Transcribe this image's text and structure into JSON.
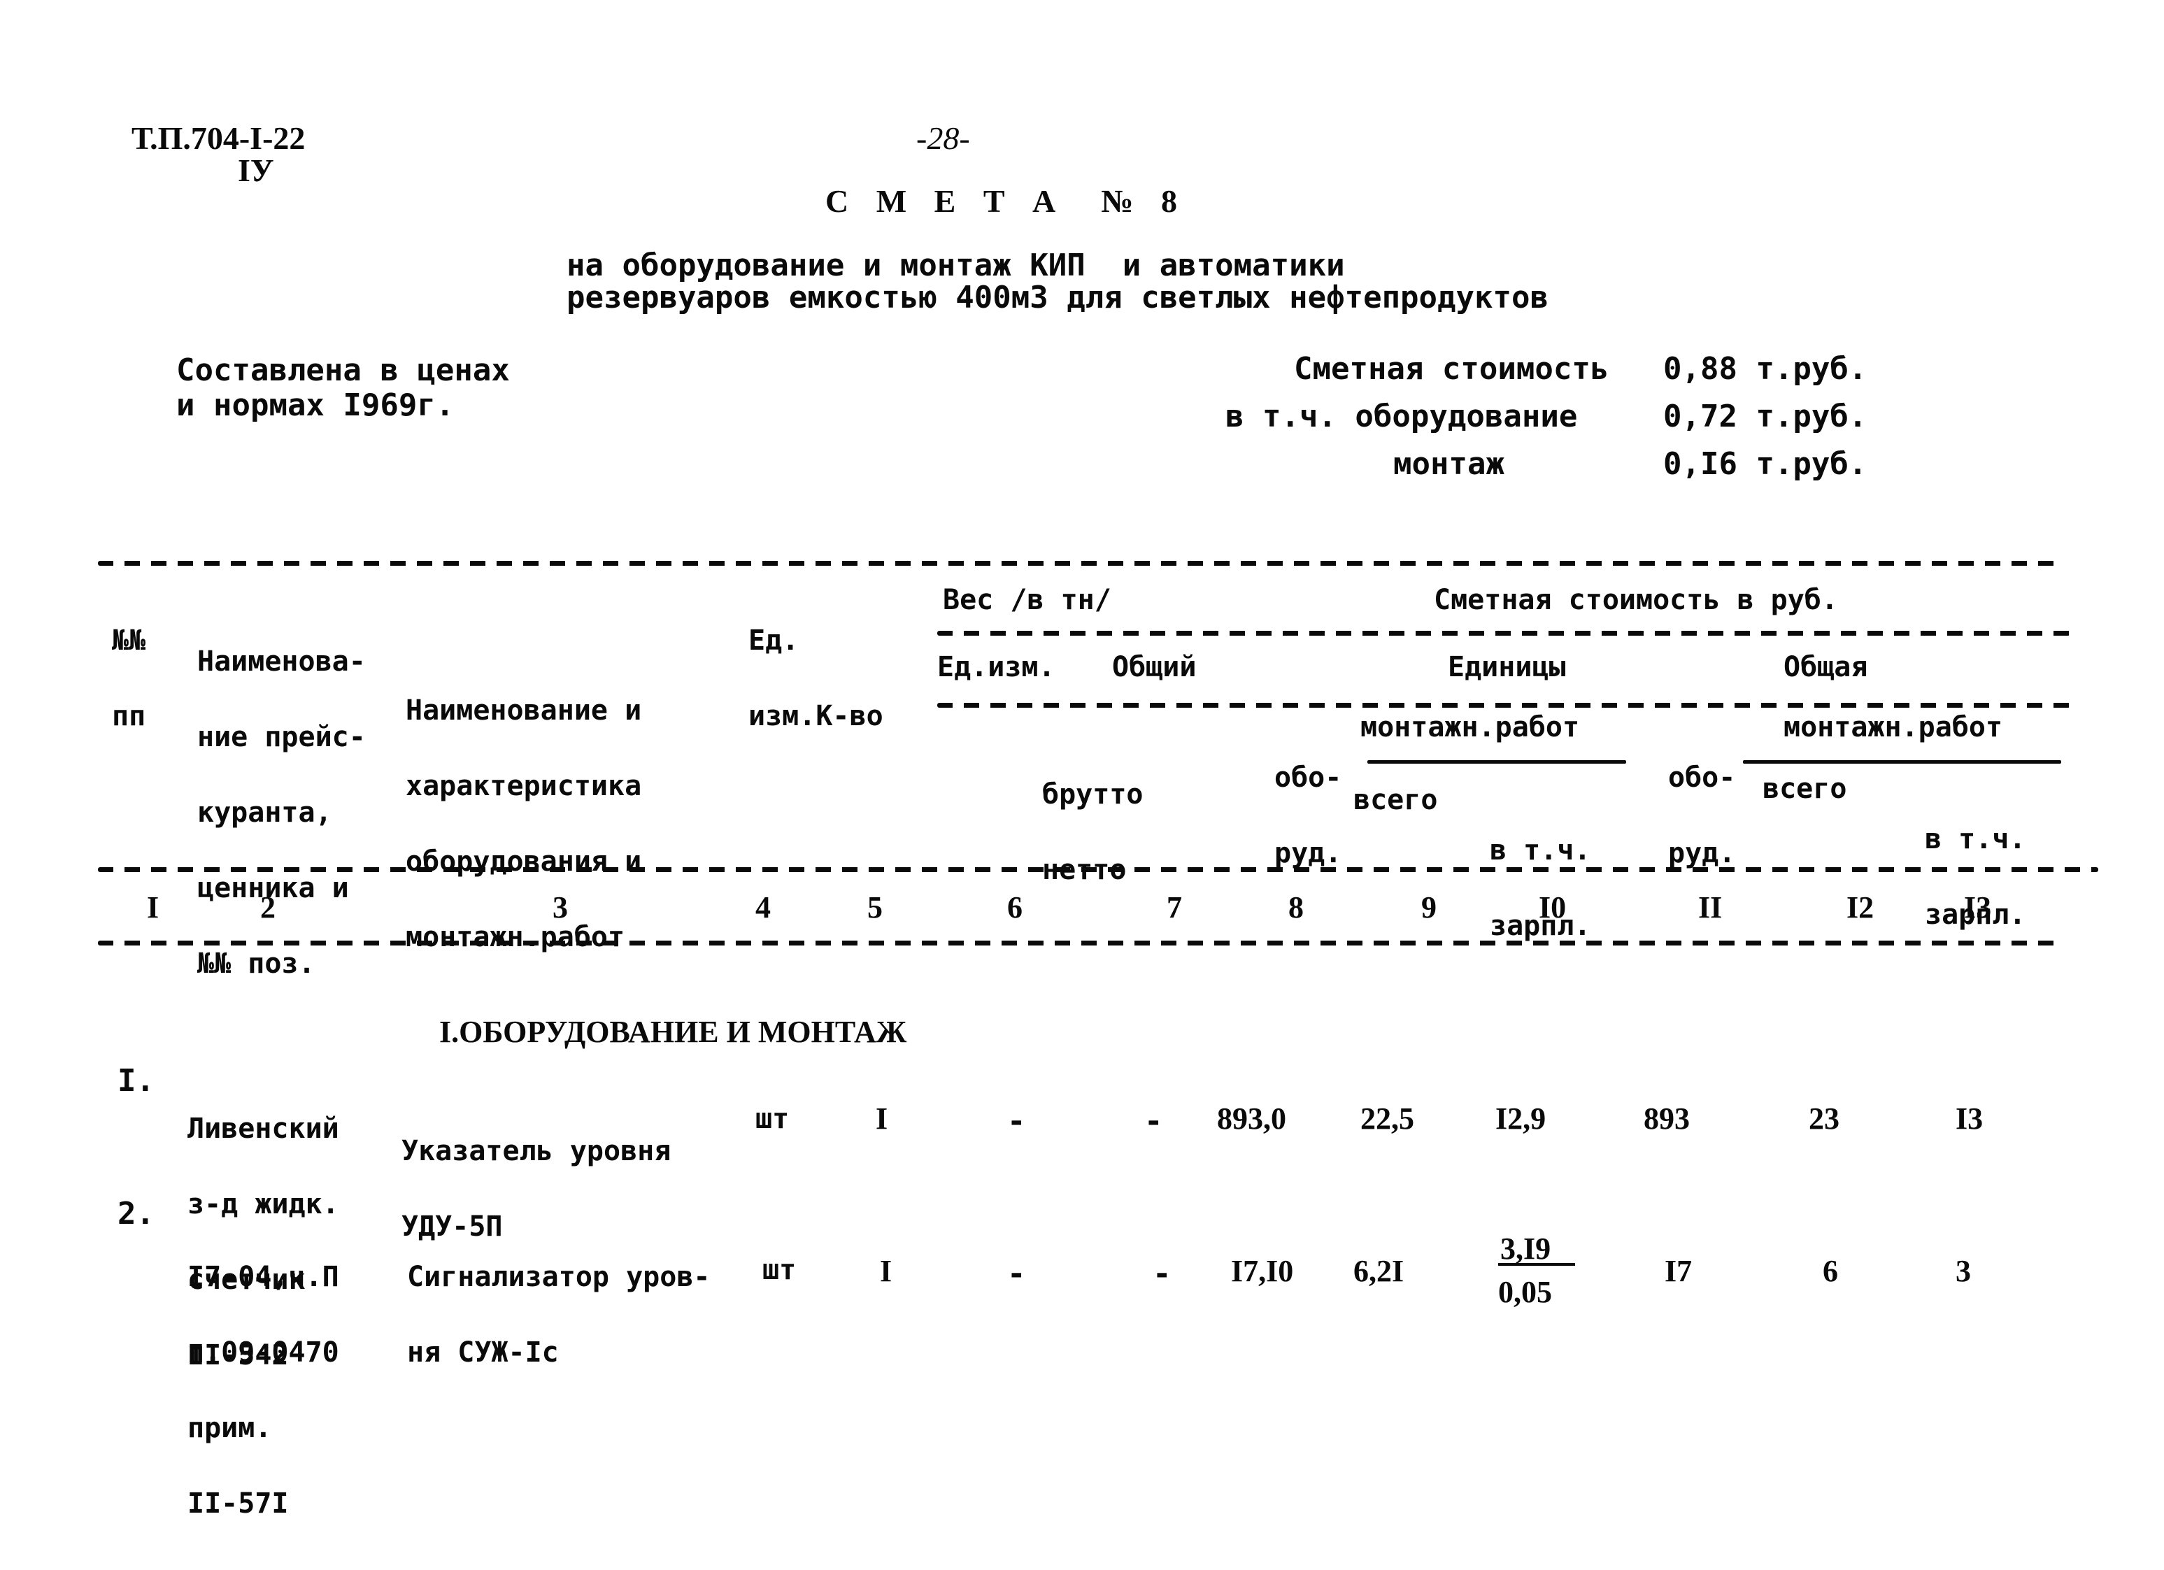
{
  "header": {
    "doc_code": "Т.П.704-I-22",
    "doc_subcode": "IУ",
    "page_number": "-28-",
    "title": "С М Е Т А  № 8",
    "subtitle_line1": "на оборудование и монтаж КИП  и автоматики",
    "subtitle_line2": "резервуаров емкостью 400м3 для светлых нефтепродуктов"
  },
  "prices_basis": {
    "line1": "Составлена в ценах",
    "line2": "и нормах I969г."
  },
  "cost_summary": {
    "total_label": "Сметная стоимость",
    "total_value": "0,88 т.руб.",
    "equipment_label": "в т.ч. оборудование",
    "equipment_value": "0,72 т.руб.",
    "installation_label": "монтаж",
    "installation_value": "0,I6 т.руб."
  },
  "table": {
    "headers": {
      "col1": [
        "№№",
        "пп"
      ],
      "col2": [
        "Наименова-",
        "ние прейс-",
        "куранта,",
        "ценника и",
        "№№ поз."
      ],
      "col3": [
        "Наименование и",
        "характеристика",
        "оборудования и",
        "монтажн.работ"
      ],
      "col45": [
        "Ед.",
        "изм.К-во"
      ],
      "weight_group": "Вес /в тн/",
      "weight_unit": "Ед.изм.",
      "weight_total": "Общий",
      "weight_sub": [
        "брутто",
        "нетто"
      ],
      "cost_group": "Сметная стоимость в руб.",
      "unit_group": "Единицы",
      "total_group": "Общая",
      "equip": [
        "обо-",
        "руд."
      ],
      "install": "монтажн.работ",
      "install_all": "всего",
      "install_wages": [
        "в т.ч.",
        "зарпл."
      ]
    },
    "column_numbers": [
      "I",
      "2",
      "3",
      "4",
      "5",
      "6",
      "7",
      "8",
      "9",
      "I0",
      "II",
      "I2",
      "I3"
    ],
    "section_title": "I.ОБОРУДОВАНИЕ И МОНТАЖ",
    "rows": [
      {
        "num": "I.",
        "pricelist": [
          "Ливенский",
          "з-д жидк.",
          "счетчик",
          "II-542"
        ],
        "name": [
          "Указатель уровня",
          "УДУ-5П"
        ],
        "unit": "шт",
        "qty": "I",
        "weight_unit": "-",
        "weight_total": "-",
        "unit_equip": "893,0",
        "unit_install_all": "22,5",
        "unit_install_wages": "I2,9",
        "unit_install_wages_sub": "",
        "total_equip": "893",
        "total_install_all": "23",
        "total_install_wages": "I3"
      },
      {
        "num": "2.",
        "pricelist": [
          "I7-04,ч.П",
          "п.09-0470",
          "прим.",
          "II-57I"
        ],
        "name": [
          "Сигнализатор уров-",
          "ня СУЖ-Iс"
        ],
        "unit": "шт",
        "qty": "I",
        "weight_unit": "-",
        "weight_total": "-",
        "unit_equip": "I7,I0",
        "unit_install_all": "6,2I",
        "unit_install_wages": "3,I9",
        "unit_install_wages_sub": "0,05",
        "total_equip": "I7",
        "total_install_all": "6",
        "total_install_wages": "3"
      }
    ]
  }
}
